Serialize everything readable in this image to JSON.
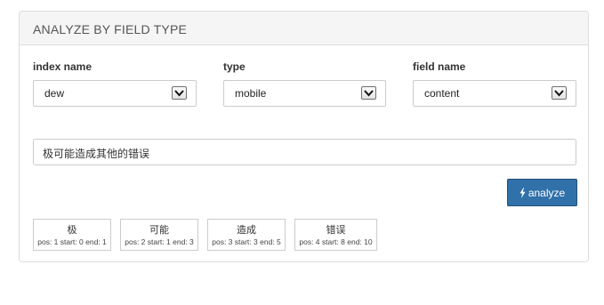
{
  "panel": {
    "title": "ANALYZE BY FIELD TYPE"
  },
  "fields": [
    {
      "label": "index name",
      "value": "dew"
    },
    {
      "label": "type",
      "value": "mobile"
    },
    {
      "label": "field name",
      "value": "content"
    }
  ],
  "input": {
    "value": "极可能造成其他的错误"
  },
  "analyze_button": {
    "icon": "bolt-icon",
    "label": "analyze",
    "color": "#3071a9"
  },
  "tokens": [
    {
      "text": "极",
      "info": "pos: 1 start: 0 end: 1"
    },
    {
      "text": "可能",
      "info": "pos: 2 start: 1 end: 3"
    },
    {
      "text": "造成",
      "info": "pos: 3 start: 3 end: 5"
    },
    {
      "text": "错误",
      "info": "pos: 4 start: 8 end: 10"
    }
  ]
}
